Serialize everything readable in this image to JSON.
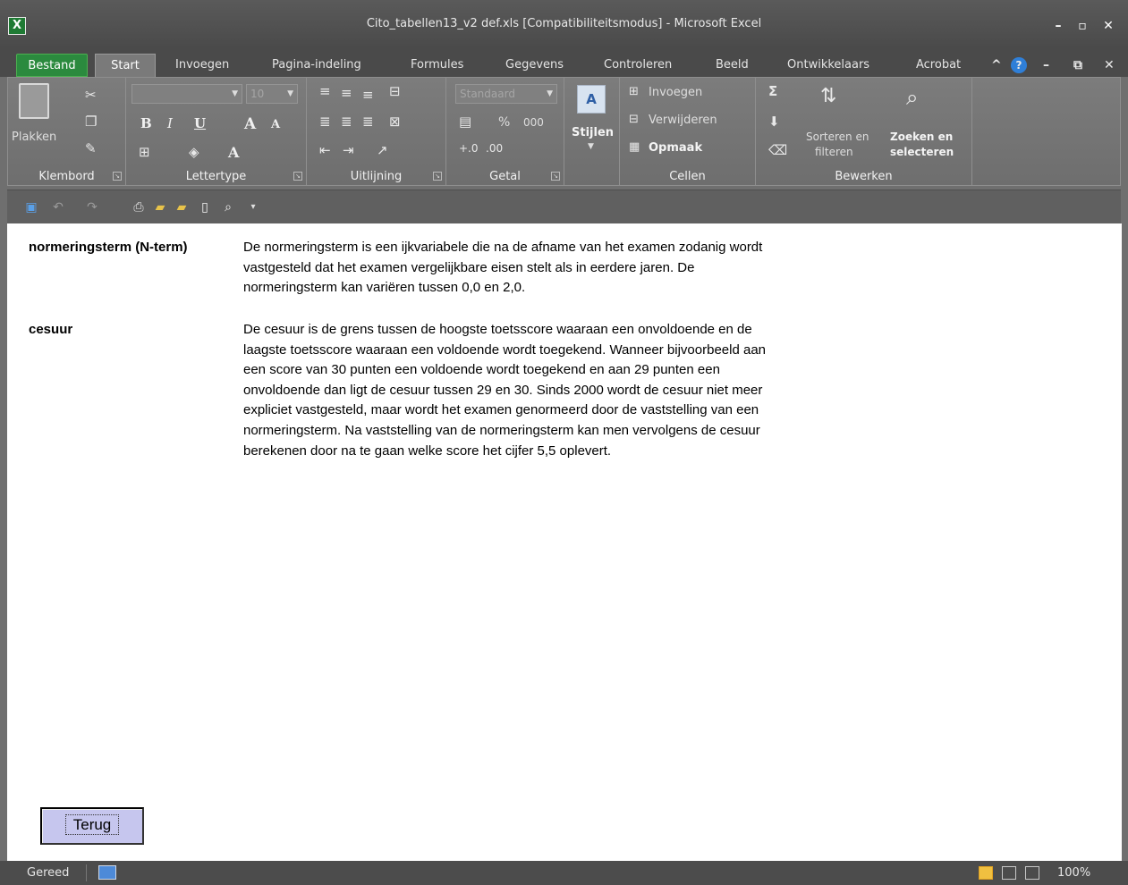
{
  "window": {
    "title": "Cito_tabellen13_v2 def.xls  [Compatibiliteitsmodus]  -  Microsoft Excel",
    "app_icon": "X",
    "controls": {
      "minimize": "–",
      "maximize": "▫",
      "close": "✕"
    }
  },
  "tabs": [
    "Bestand",
    "Start",
    "Invoegen",
    "Pagina-indeling",
    "Formules",
    "Gegevens",
    "Controleren",
    "Beeld",
    "Ontwikkelaars",
    "Acrobat"
  ],
  "tab_icons": {
    "collapse": "^",
    "help": "?",
    "minimize": "–",
    "restore": "⧉",
    "close": "✕"
  },
  "ribbon": {
    "clipboard": {
      "paste": "Plakken",
      "label": "Klembord"
    },
    "font": {
      "name": "",
      "size": "10",
      "label": "Lettertype"
    },
    "alignment": {
      "label": "Uitlijning"
    },
    "number": {
      "format": "Standaard",
      "percent": "%",
      "thousands": "000",
      "label": "Getal"
    },
    "styles": {
      "label": "Stijlen"
    },
    "cells": {
      "insert": "Invoegen",
      "delete": "Verwijderen",
      "format": "Opmaak",
      "label": "Cellen"
    },
    "editing": {
      "sort_line1": "Sorteren en",
      "sort_line2": "filteren",
      "find_line1": "Zoeken en",
      "find_line2": "selecteren",
      "label": "Bewerken"
    }
  },
  "content": {
    "entries": [
      {
        "term": "normeringsterm (N-term)",
        "definition": "De normeringsterm is een ijkvariabele die na de afname van het examen zodanig wordt\nvastgesteld dat het examen vergelijkbare eisen stelt als in eerdere jaren. De\nnormeringsterm kan variëren tussen 0,0 en 2,0."
      },
      {
        "term": "cesuur",
        "definition": "De cesuur is de grens tussen de hoogste toetsscore waaraan een onvoldoende en de\nlaagste toetsscore waaraan een voldoende wordt toegekend. Wanneer bijvoorbeeld aan\neen score van 30 punten een voldoende wordt toegekend en aan 29 punten een\nonvoldoende dan ligt de cesuur tussen 29 en 30. Sinds 2000 wordt de cesuur niet meer\nexpliciet vastgesteld, maar wordt het examen genormeerd door de vaststelling van een\nnormeringsterm. Na vaststelling van de normeringsterm kan men vervolgens de cesuur\nberekenen door na te gaan welke score het cijfer 5,5 oplevert."
      }
    ],
    "back_button": "Terug"
  },
  "status": {
    "ready": "Gereed",
    "zoom": "100%"
  },
  "colors": {
    "file_tab": "#2b8a3e",
    "button_fill": "#c6c6ee"
  }
}
